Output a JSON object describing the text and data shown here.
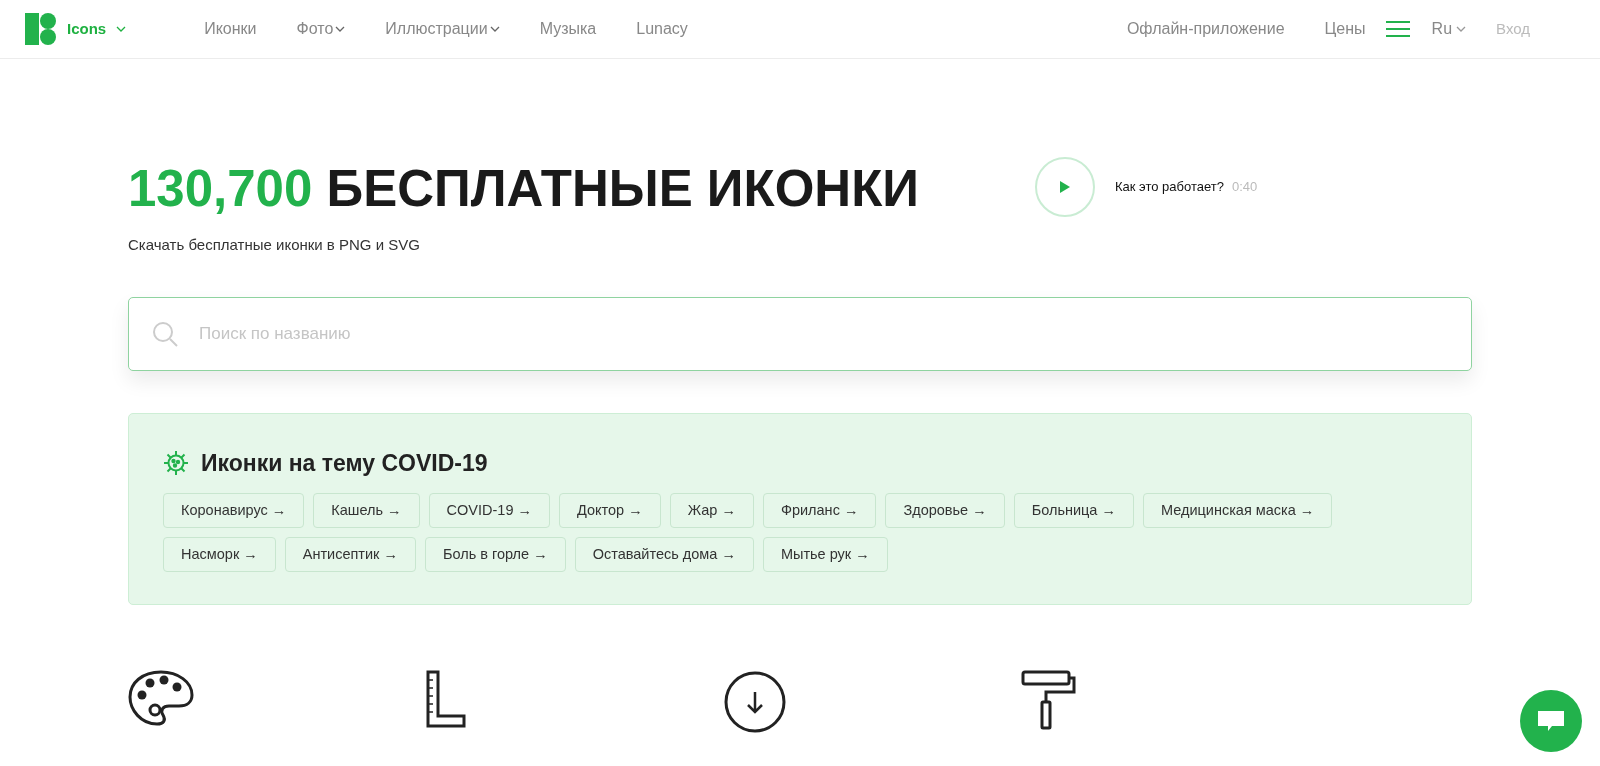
{
  "header": {
    "brand": "Icons",
    "nav": [
      {
        "label": "Иконки",
        "dropdown": false
      },
      {
        "label": "Фото",
        "dropdown": true
      },
      {
        "label": "Иллюстрации",
        "dropdown": true
      },
      {
        "label": "Музыка",
        "dropdown": false
      },
      {
        "label": "Lunacy",
        "dropdown": false
      }
    ],
    "right_links": [
      "Офлайн-приложение",
      "Цены"
    ],
    "language": "Ru",
    "login": "Вход"
  },
  "hero": {
    "count": "130,700",
    "title": "БЕСПЛАТНЫЕ ИКОНКИ",
    "subtitle": "Скачать бесплатные иконки в PNG и SVG",
    "video_label": "Как это работает?",
    "video_duration": "0:40"
  },
  "search": {
    "placeholder": "Поиск по названию"
  },
  "covid": {
    "title": "Иконки на тему COVID-19",
    "tags": [
      "Коронавирус →",
      "Кашель →",
      "COVID-19 →",
      "Доктор →",
      "Жар →",
      "Фриланс →",
      "Здоровье →",
      "Больница →",
      "Медицинская маска →",
      "Насморк →",
      "Антисептик →",
      "Боль в горле →",
      "Оставайтесь дома →",
      "Мытье рук →"
    ]
  },
  "features": [
    {
      "kind": "palette"
    },
    {
      "kind": "ruler"
    },
    {
      "kind": "download"
    },
    {
      "kind": "roller"
    }
  ]
}
